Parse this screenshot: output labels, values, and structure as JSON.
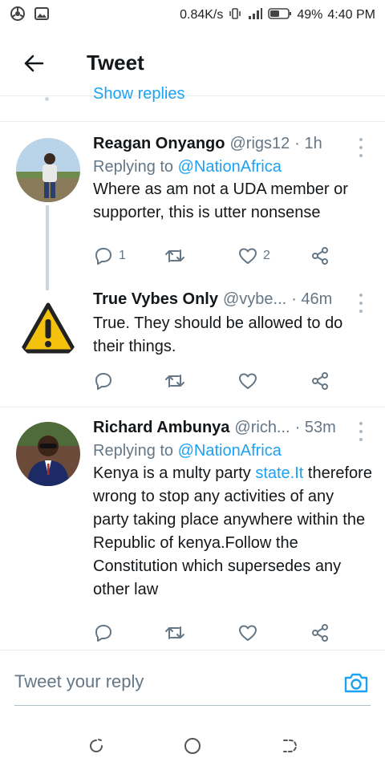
{
  "status_bar": {
    "speed": "0.84K/s",
    "battery": "49%",
    "time": "4:40 PM"
  },
  "header": {
    "title": "Tweet"
  },
  "show_replies": "Show replies",
  "tweets": [
    {
      "name": "Reagan Onyango",
      "handle": "@rigs12",
      "time": "· 1h",
      "replying_prefix": "Replying to",
      "replying_to": "@NationAfrica",
      "text": "Where as am not a UDA member or supporter, this is utter nonsense",
      "reply_count": "1",
      "retweet_count": "",
      "like_count": "2"
    },
    {
      "name": "True Vybes Only",
      "handle": "@vybe...",
      "time": "· 46m",
      "text": "True. They should be allowed to do their things.",
      "reply_count": "",
      "retweet_count": "",
      "like_count": ""
    },
    {
      "name": "Richard Ambunya",
      "handle": "@rich...",
      "time": "· 53m",
      "replying_prefix": "Replying to",
      "replying_to": "@NationAfrica",
      "text_before_link": "Kenya is a multy party ",
      "text_link": "state.It",
      "text_after_link": " therefore wrong to stop any activities of any party taking place anywhere within the Republic of kenya.Follow the Constitution which supersedes any other law",
      "reply_count": "",
      "retweet_count": "",
      "like_count": ""
    }
  ],
  "compose": {
    "placeholder": "Tweet your reply"
  },
  "colors": {
    "accent": "#1da1f2",
    "secondary_text": "#657786",
    "divider": "#e6ecf0"
  }
}
